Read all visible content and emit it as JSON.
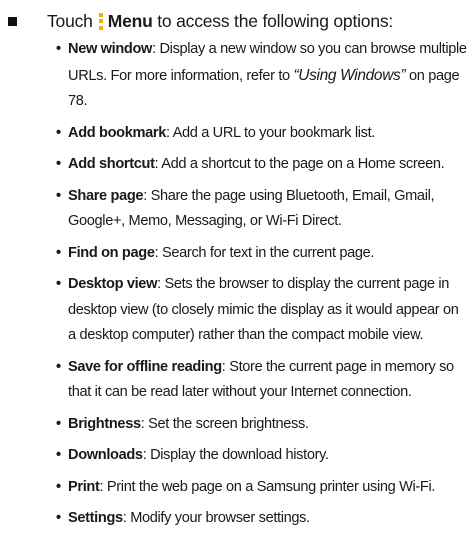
{
  "intro": {
    "prefix": "Touch",
    "menu_label": "Menu",
    "suffix": "to access the following options:"
  },
  "options": [
    {
      "name": "New window",
      "desc": ": Display a new window so you can browse multiple URLs. For more information, refer to ",
      "link": "“Using Windows”",
      "after": " on page 78."
    },
    {
      "name": "Add bookmark",
      "desc": ": Add a URL to your bookmark list."
    },
    {
      "name": "Add shortcut",
      "desc": ": Add a shortcut to the page on a Home screen."
    },
    {
      "name": "Share page",
      "desc": ": Share the page using Bluetooth, Email, Gmail, Google+, Memo, Messaging, or Wi-Fi Direct."
    },
    {
      "name": "Find on page",
      "desc": ": Search for text in the current page."
    },
    {
      "name": "Desktop view",
      "desc": ": Sets the browser to display the current page in desktop view (to closely mimic the display as it would appear on a desktop computer) rather than the compact mobile view."
    },
    {
      "name": "Save for offline reading",
      "desc": ": Store the current page in memory so that it can be read later without your Internet connection."
    },
    {
      "name": "Brightness",
      "desc": ": Set the screen brightness."
    },
    {
      "name": "Downloads",
      "desc": ": Display the download history."
    },
    {
      "name": "Print",
      "desc": ": Print the web page on a Samsung printer using Wi-Fi."
    },
    {
      "name": "Settings",
      "desc": ": Modify your browser settings."
    }
  ]
}
